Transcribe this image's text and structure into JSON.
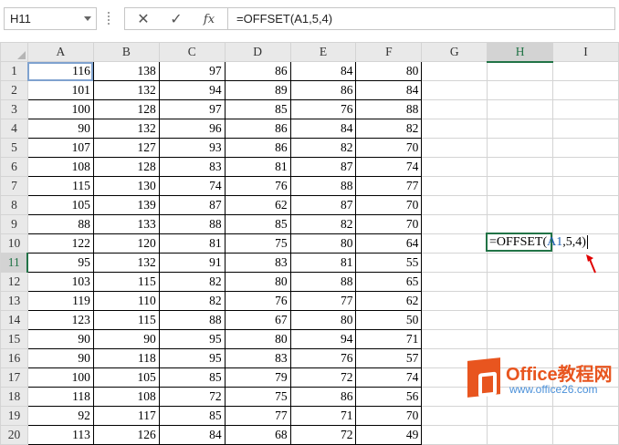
{
  "formula_bar": {
    "name_box": "H11",
    "cancel_icon": "✕",
    "enter_icon": "✓",
    "fx_label": "fx",
    "formula": "=OFFSET(A1,5,4)"
  },
  "columns": [
    "A",
    "B",
    "C",
    "D",
    "E",
    "F",
    "G",
    "H",
    "I"
  ],
  "rows": [
    {
      "n": "1",
      "v": [
        "116",
        "138",
        "97",
        "86",
        "84",
        "80"
      ]
    },
    {
      "n": "2",
      "v": [
        "101",
        "132",
        "94",
        "89",
        "86",
        "84"
      ]
    },
    {
      "n": "3",
      "v": [
        "100",
        "128",
        "97",
        "85",
        "76",
        "88"
      ]
    },
    {
      "n": "4",
      "v": [
        "90",
        "132",
        "96",
        "86",
        "84",
        "82"
      ]
    },
    {
      "n": "5",
      "v": [
        "107",
        "127",
        "93",
        "86",
        "82",
        "70"
      ]
    },
    {
      "n": "6",
      "v": [
        "108",
        "128",
        "83",
        "81",
        "87",
        "74"
      ]
    },
    {
      "n": "7",
      "v": [
        "115",
        "130",
        "74",
        "76",
        "88",
        "77"
      ]
    },
    {
      "n": "8",
      "v": [
        "105",
        "139",
        "87",
        "62",
        "87",
        "70"
      ]
    },
    {
      "n": "9",
      "v": [
        "88",
        "133",
        "88",
        "85",
        "82",
        "70"
      ]
    },
    {
      "n": "10",
      "v": [
        "122",
        "120",
        "81",
        "75",
        "80",
        "64"
      ]
    },
    {
      "n": "11",
      "v": [
        "95",
        "132",
        "91",
        "83",
        "81",
        "55"
      ]
    },
    {
      "n": "12",
      "v": [
        "103",
        "115",
        "82",
        "80",
        "88",
        "65"
      ]
    },
    {
      "n": "13",
      "v": [
        "119",
        "110",
        "82",
        "76",
        "77",
        "62"
      ]
    },
    {
      "n": "14",
      "v": [
        "123",
        "115",
        "88",
        "67",
        "80",
        "50"
      ]
    },
    {
      "n": "15",
      "v": [
        "90",
        "90",
        "95",
        "80",
        "94",
        "71"
      ]
    },
    {
      "n": "16",
      "v": [
        "90",
        "118",
        "95",
        "83",
        "76",
        "57"
      ]
    },
    {
      "n": "17",
      "v": [
        "100",
        "105",
        "85",
        "79",
        "72",
        "74"
      ]
    },
    {
      "n": "18",
      "v": [
        "118",
        "108",
        "72",
        "75",
        "86",
        "56"
      ]
    },
    {
      "n": "19",
      "v": [
        "92",
        "117",
        "85",
        "77",
        "71",
        "70"
      ]
    },
    {
      "n": "20",
      "v": [
        "113",
        "126",
        "84",
        "68",
        "72",
        "49"
      ]
    }
  ],
  "editing_cell": {
    "prefix": "=OFFSET(",
    "ref": "A1",
    "suffix": ",5,4)"
  },
  "watermark": {
    "title": "Office教程网",
    "url": "www.office26.com"
  },
  "colors": {
    "accent_green": "#217346",
    "ref_blue": "#1f5fb0",
    "arrow_red": "#e00000",
    "logo_orange": "#e8551f"
  }
}
